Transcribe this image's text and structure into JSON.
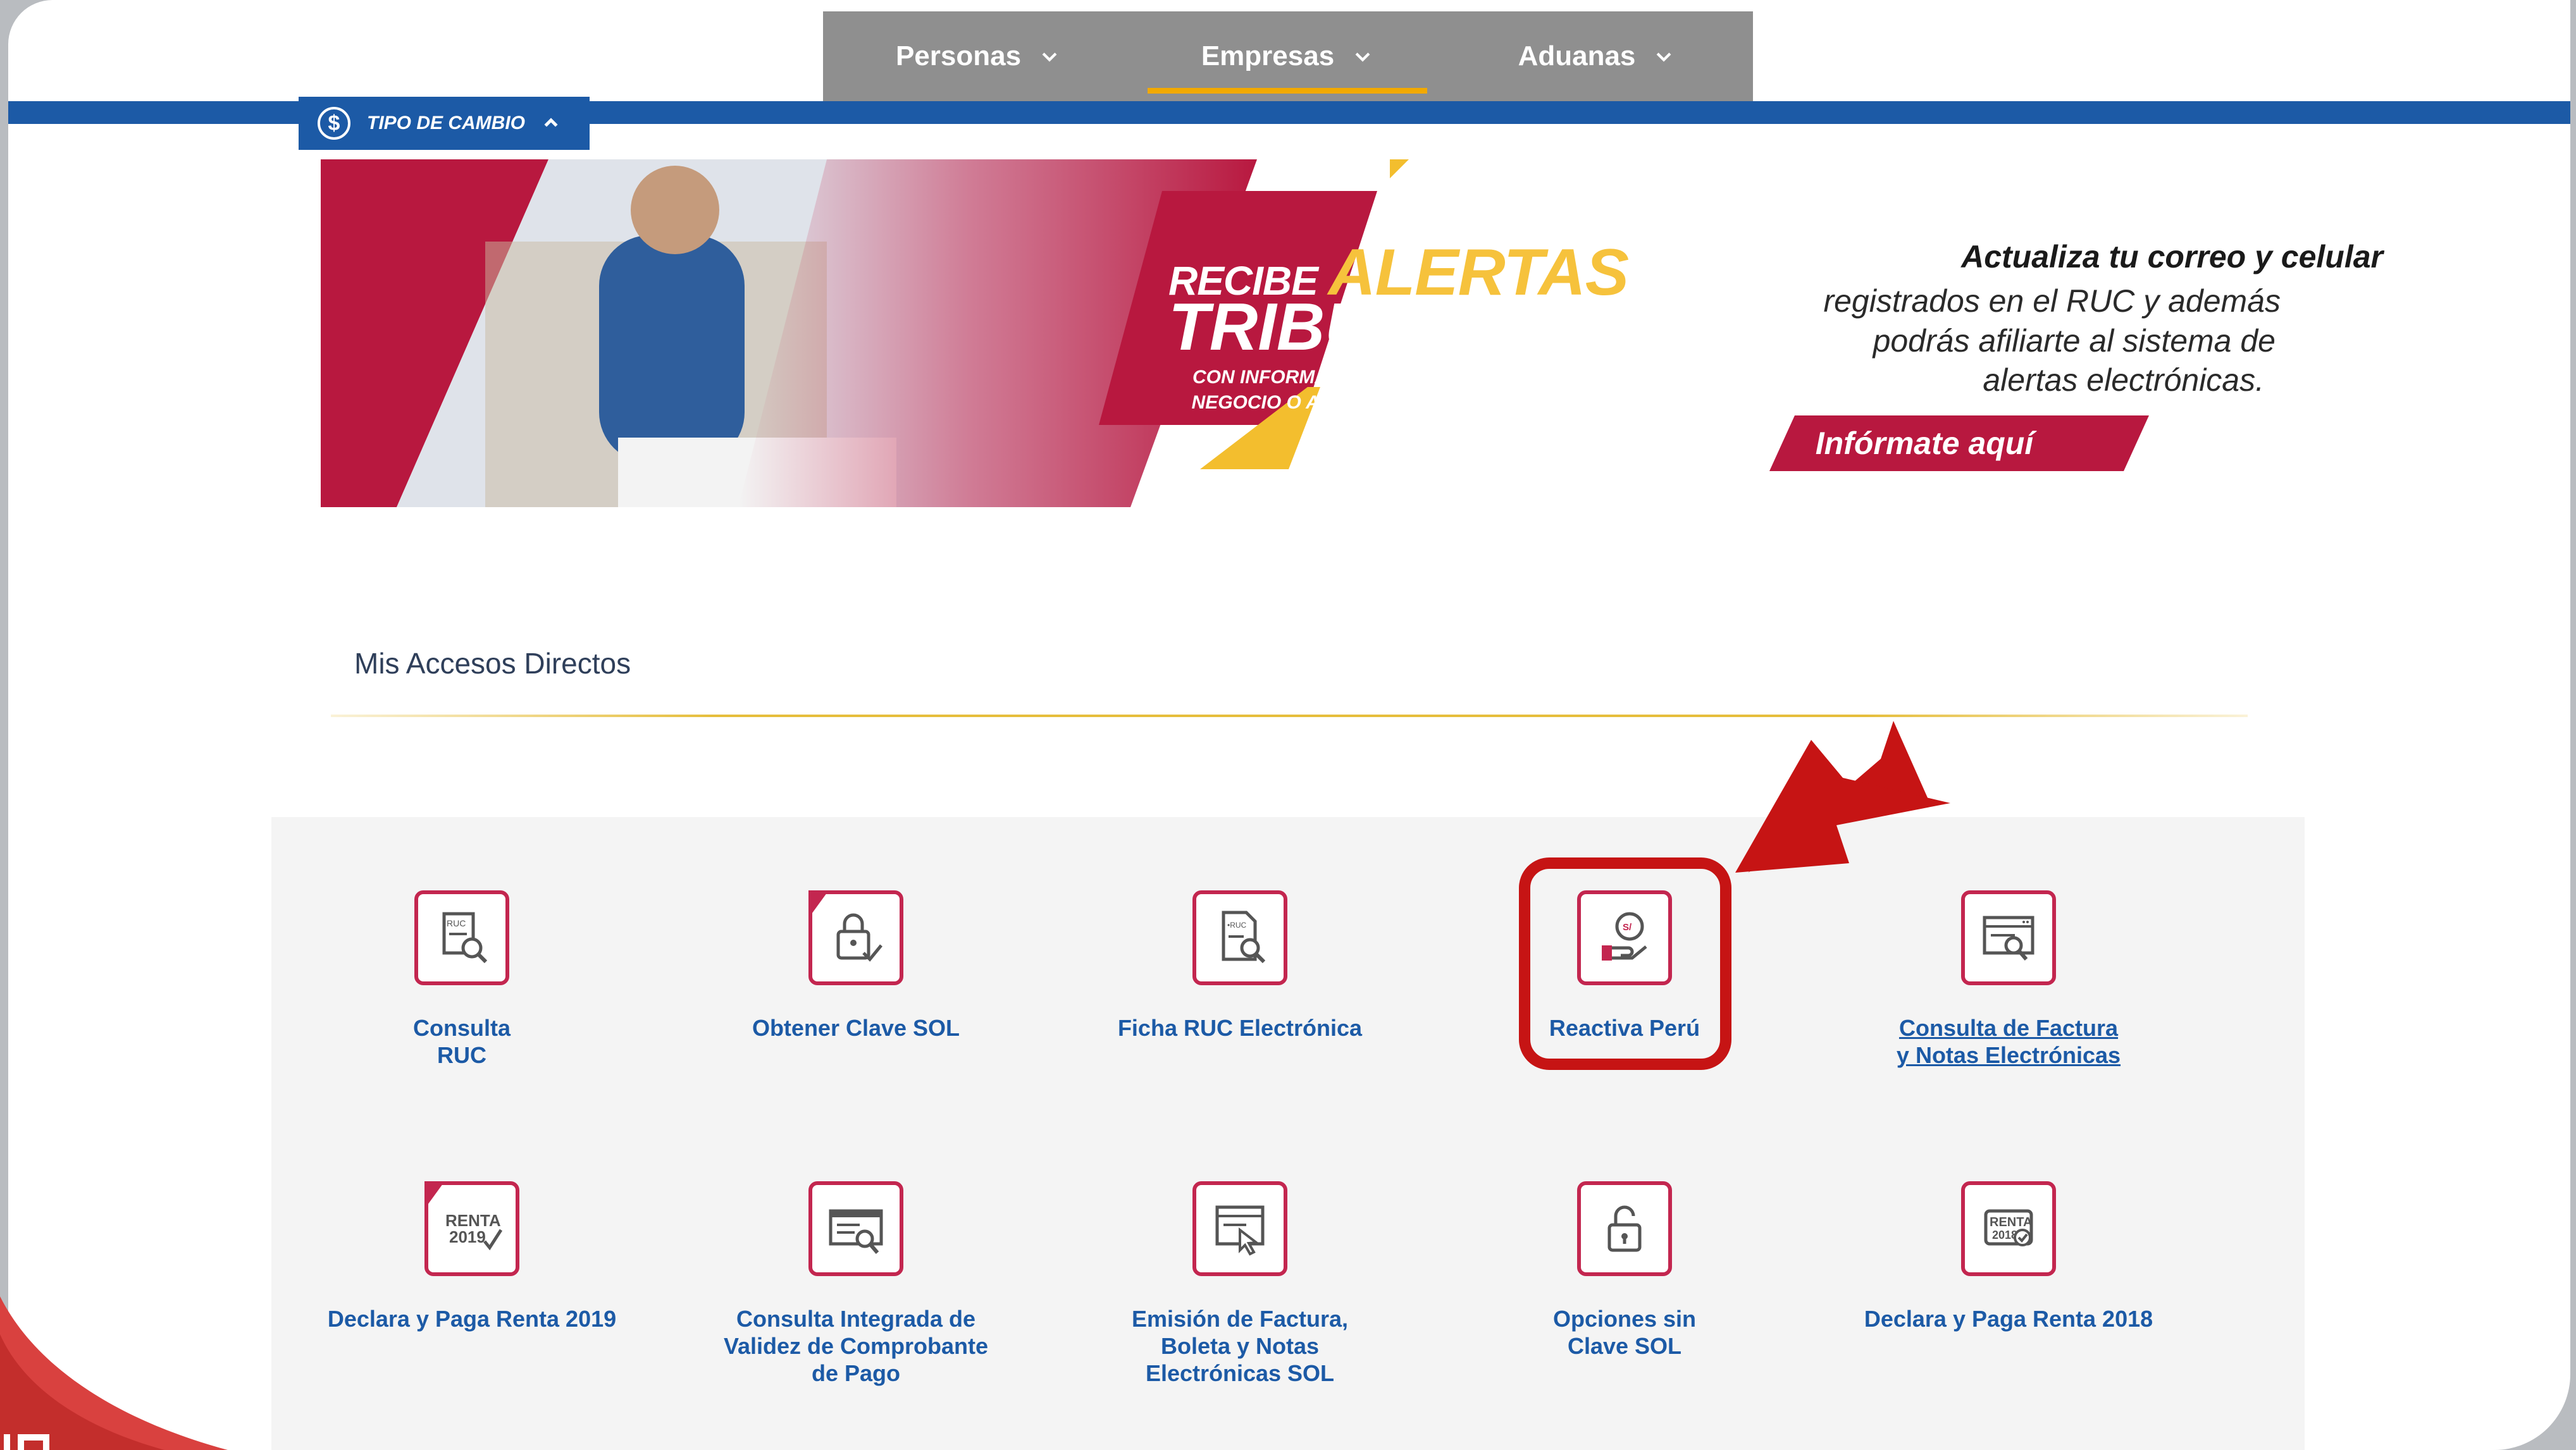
{
  "nav": {
    "tabs": [
      {
        "label": "Personas",
        "active": false
      },
      {
        "label": "Empresas",
        "active": true
      },
      {
        "label": "Aduanas",
        "active": false
      }
    ]
  },
  "tipo_cambio": {
    "label": "TIPO DE CAMBIO",
    "icon": "dollar-circle-icon"
  },
  "banner": {
    "recibe": "RECIBE",
    "alertas": "ALERTAS",
    "tributarias": "TRIBUTARIAS",
    "sub1": "CON INFORMACIÓN CLAVE PARA TU",
    "sub2": "NEGOCIO O ACTIVIDAD ECONÓMICA",
    "side_title": "Actualiza tu correo y celular",
    "side_line1": "registrados en el RUC y además",
    "side_line2": "podrás afiliarte al sistema de",
    "side_line3": "alertas electrónicas.",
    "cta": "Infórmate aquí"
  },
  "section": {
    "title": "Mis Accesos Directos"
  },
  "tiles": [
    {
      "label": "Consulta\nRUC",
      "icon": "ruc-search-icon",
      "link": false
    },
    {
      "label": "Obtener Clave SOL",
      "icon": "lock-document-icon",
      "link": false
    },
    {
      "label": "Ficha RUC Electrónica",
      "icon": "ruc-file-icon",
      "link": false
    },
    {
      "label": "Reactiva Perú",
      "icon": "hand-coin-icon",
      "link": false
    },
    {
      "label": "Consulta de Factura\ny Notas Electrónicas",
      "icon": "invoice-search-icon",
      "link": true
    },
    {
      "label": "Declara y Paga Renta 2019",
      "icon": "renta-2019-icon",
      "link": false
    },
    {
      "label": "Consulta Integrada de\nValidez de Comprobante\nde Pago",
      "icon": "receipt-search-icon",
      "link": false
    },
    {
      "label": "Emisión de Factura,\nBoleta y Notas\nElectrónicas SOL",
      "icon": "window-cursor-icon",
      "link": false
    },
    {
      "label": "Opciones sin\nClave SOL",
      "icon": "open-lock-icon",
      "link": false
    },
    {
      "label": "Declara y Paga Renta 2018",
      "icon": "renta-2018-icon",
      "link": false
    }
  ],
  "colors": {
    "brand_blue": "#1c5aa6",
    "crimson": "#c3264f",
    "highlight_red": "#c61414",
    "accent_yellow": "#f2a900"
  }
}
